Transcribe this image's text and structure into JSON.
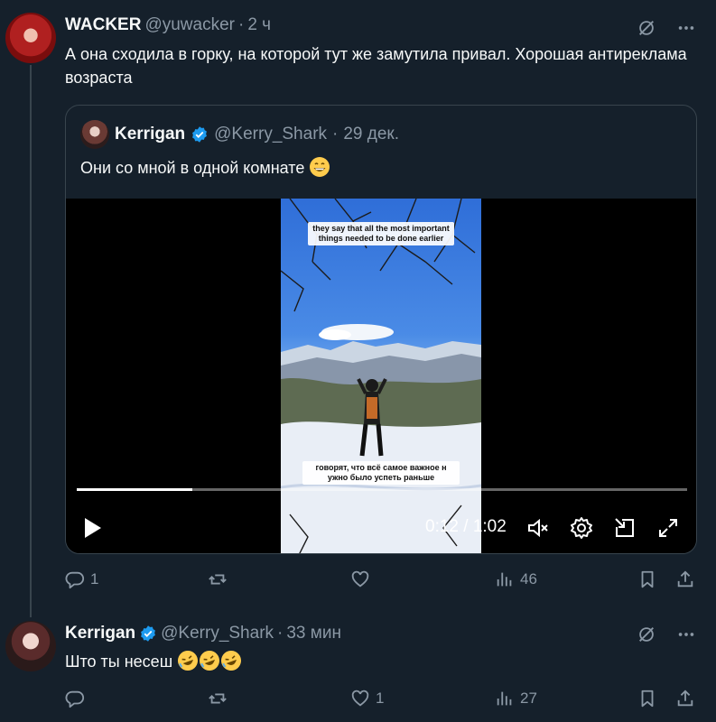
{
  "colors": {
    "background": "#15202b",
    "muted": "#8b98a5",
    "verified": "#1d9bf0",
    "border": "#38444d"
  },
  "tweet1": {
    "name": "WACKER",
    "handle": "@yuwacker",
    "separator": "·",
    "time": "2 ч",
    "text": "А она сходила в горку, на которой тут же замутила привал. Хорошая антиреклама возраста",
    "quote": {
      "name": "Kerrigan",
      "handle": "@Kerry_Shark",
      "separator": "·",
      "time": "29 дек.",
      "text": "Они со мной в одной комнате",
      "emoji": "grinning-face-emoji",
      "video": {
        "caption_top": "they say that all the most important things needed to be done earlier",
        "caption_bottom": "говорят, что всё самое важное н ужно было успеть раньше",
        "current_time": "0:12",
        "time_separator": "/",
        "duration": "1:02",
        "progress_fraction": 0.19
      }
    },
    "actions": {
      "replies": "1",
      "reposts": "",
      "likes": "",
      "views": "46"
    }
  },
  "tweet2": {
    "name": "Kerrigan",
    "handle": "@Kerry_Shark",
    "separator": "·",
    "time": "33 мин",
    "text": "Што ты несеш",
    "emoji": [
      "rolling-laughing-emoji",
      "rolling-laughing-emoji",
      "rolling-laughing-emoji"
    ],
    "actions": {
      "replies": "",
      "reposts": "",
      "likes": "1",
      "views": "27"
    }
  }
}
